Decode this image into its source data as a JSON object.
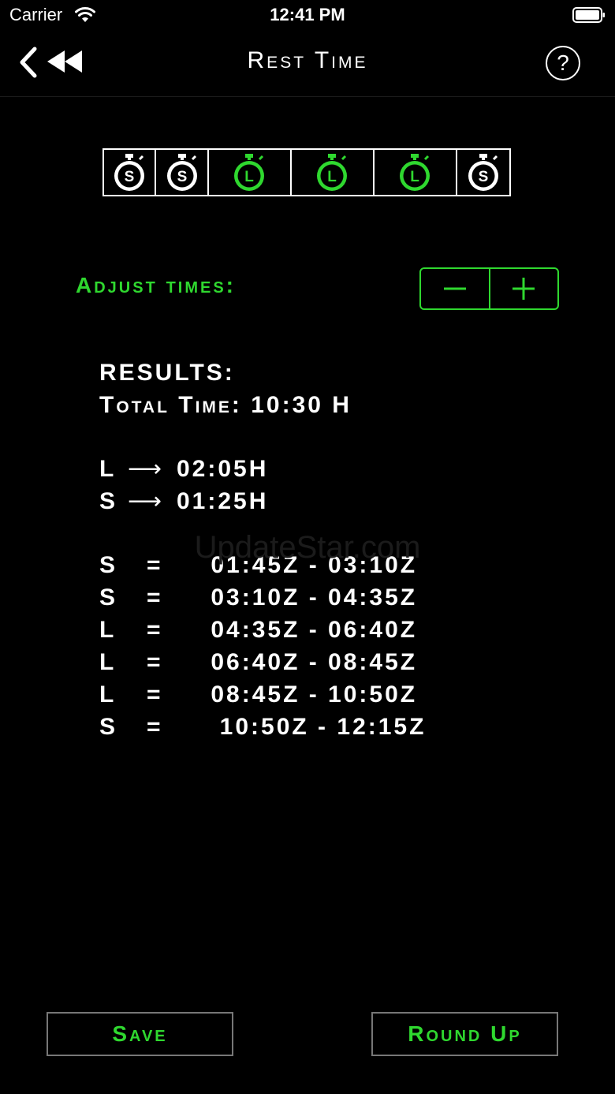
{
  "status_bar": {
    "carrier": "Carrier",
    "time": "12:41 PM"
  },
  "nav": {
    "title": "Rest Time",
    "help_label": "?"
  },
  "segments": [
    {
      "type": "S",
      "active": false
    },
    {
      "type": "S",
      "active": false
    },
    {
      "type": "L",
      "active": true
    },
    {
      "type": "L",
      "active": true
    },
    {
      "type": "L",
      "active": true
    },
    {
      "type": "S",
      "active": false
    }
  ],
  "adjust": {
    "label": "Adjust times:"
  },
  "results": {
    "heading": "RESULTS:",
    "total": "Total Time: 10:30 H",
    "long_label": "L",
    "long_duration": "02:05H",
    "short_label": "S",
    "short_duration": "01:25H",
    "slots": [
      {
        "type": "S",
        "eq": "=",
        "range": " 01:45Z - 03:10Z"
      },
      {
        "type": "S",
        "eq": "=",
        "range": " 03:10Z - 04:35Z"
      },
      {
        "type": "L",
        "eq": "=",
        "range": " 04:35Z - 06:40Z"
      },
      {
        "type": "L",
        "eq": "=",
        "range": " 06:40Z - 08:45Z"
      },
      {
        "type": "L",
        "eq": "=",
        "range": " 08:45Z - 10:50Z"
      },
      {
        "type": "S",
        "eq": "=",
        "range": "  10:50Z - 12:15Z"
      }
    ]
  },
  "watermark": "UpdateStar.com",
  "buttons": {
    "save": "Save",
    "round_up": "Round Up"
  },
  "colors": {
    "accent": "#2fd82f",
    "background": "#000000",
    "text": "#ffffff"
  },
  "icons": {
    "back": "chevron-left-icon",
    "rewind": "rewind-icon",
    "help": "question-circle-icon",
    "stopwatch": "stopwatch-icon",
    "minus": "minus-icon",
    "plus": "plus-icon"
  }
}
